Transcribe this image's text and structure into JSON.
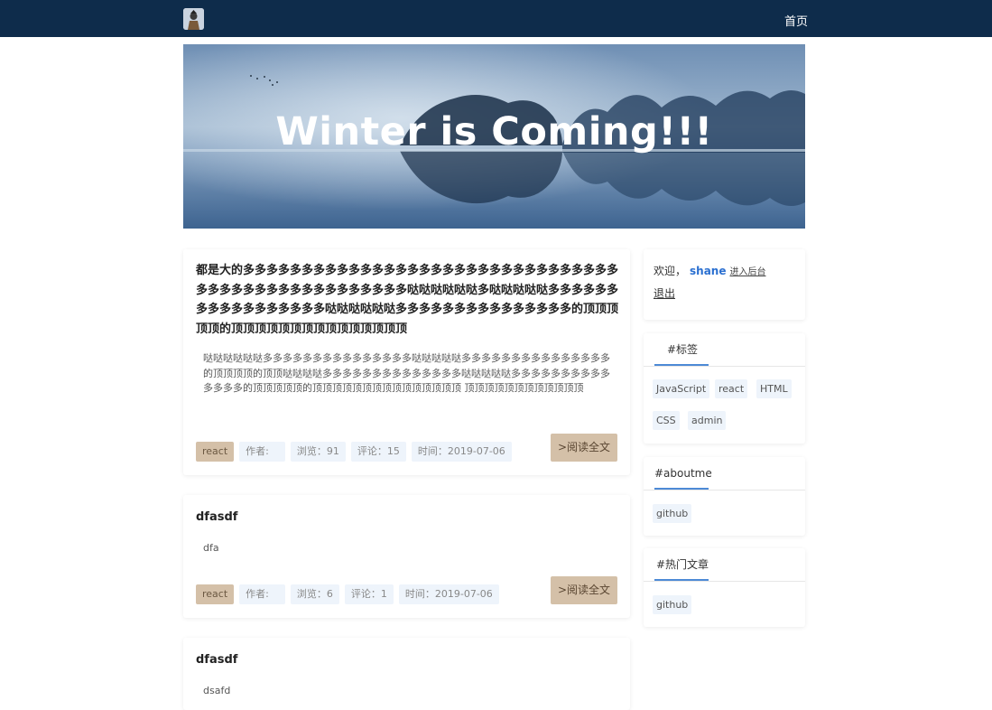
{
  "nav": {
    "home": "首页"
  },
  "banner": {
    "title": "Winter is Coming!!!"
  },
  "posts": [
    {
      "title": "都是大的多多多多多多多多多多多多多多多多多多多多多多多多多多多多多多多多多多多多多多多多多多多多多多多多多多哒哒哒哒哒哒多哒哒哒哒哒多多多多多多多多多多多多多多多多多哒哒哒哒哒哒多多多多多多多多多多多多多多多的顶顶顶顶顶的顶顶顶顶顶顶顶顶顶顶顶顶顶顶顶",
      "summary": "哒哒哒哒哒哒多多多多多多多多多多多多多多多哒哒哒哒哒多多多多多多多多多多多多多多多的顶顶顶顶的顶顶哒哒哒哒多多多多多多多多多多多多多多哒哒哒哒哒多多多多多多多多多多多多多多的顶顶顶顶顶的顶顶顶顶顶顶顶顶顶顶顶顶顶顶顶 顶顶顶顶顶顶顶顶顶顶顶顶",
      "tag": "react",
      "author": "作者:",
      "views": "浏览：91",
      "comments": "评论：15",
      "time": "时间：2019-07-06",
      "read": ">阅读全文"
    },
    {
      "title": "dfasdf",
      "summary": "dfa",
      "tag": "react",
      "author": "作者:",
      "views": "浏览：6",
      "comments": "评论：1",
      "time": "时间：2019-07-06",
      "read": ">阅读全文"
    },
    {
      "title": "dfasdf",
      "summary": "dsafd"
    }
  ],
  "sidebar": {
    "welcome": "欢迎，",
    "username": "shane",
    "admin_link": "进入后台",
    "logout": "退出",
    "tags_title": "#标签",
    "tags": [
      "JavaScript",
      "react",
      "HTML",
      "CSS",
      "admin"
    ],
    "aboutme_title": "#aboutme",
    "aboutme_links": [
      "github"
    ],
    "hot_title": "#热门文章",
    "hot_links": [
      "github"
    ]
  },
  "colors": {
    "topbar": "#0e2c4b",
    "accent": "#4d8ad6",
    "tag_bg": "#d4c0a8",
    "chip_bg": "#eef4fb"
  }
}
